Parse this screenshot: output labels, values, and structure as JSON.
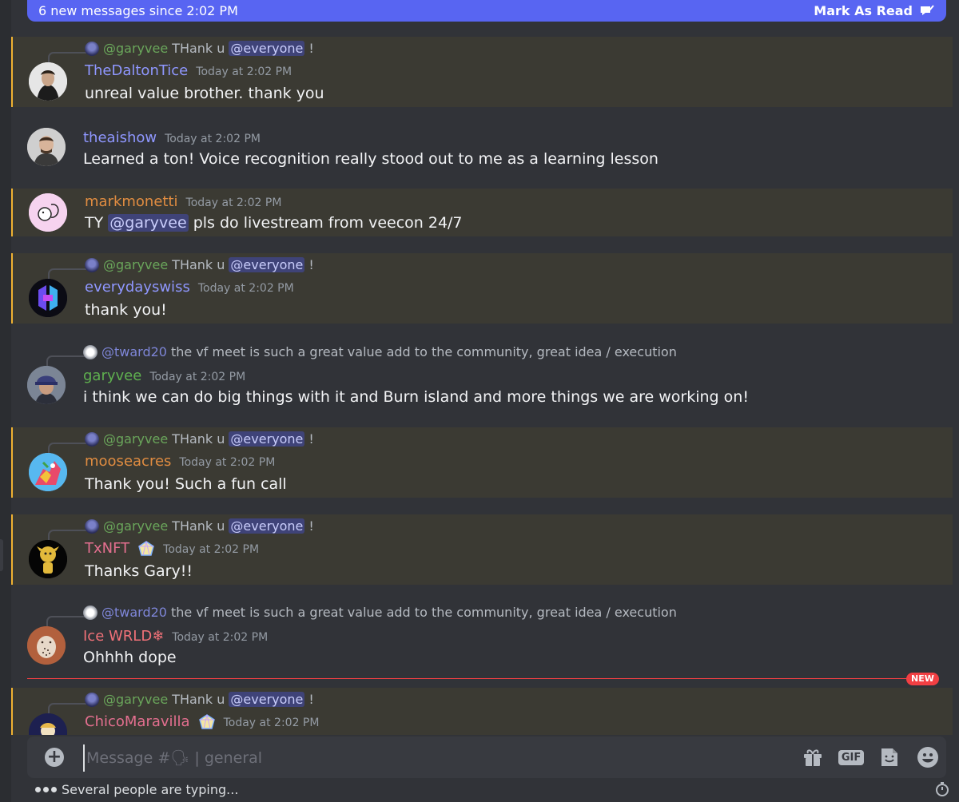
{
  "banner": {
    "text": "6 new messages since 2:02 PM",
    "action": "Mark As Read"
  },
  "messages": [
    {
      "reply": {
        "user": "@garyvee",
        "text": "THank u",
        "mention": "@everyone",
        "tail": "!"
      },
      "author": "TheDaltonTice",
      "time": "Today at 2:02 PM",
      "content": "unreal value brother. thank you"
    },
    {
      "author": "theaishow",
      "time": "Today at 2:02 PM",
      "content": "Learned a ton! Voice recognition really stood out to me as a learning lesson"
    },
    {
      "author": "markmonetti",
      "time": "Today at 2:02 PM",
      "content": {
        "pre": "TY",
        "mention": "@garyvee",
        "post": "pls do livestream from veecon 24/7"
      }
    },
    {
      "reply": {
        "user": "@garyvee",
        "text": "THank u",
        "mention": "@everyone",
        "tail": "!"
      },
      "author": "everydayswiss",
      "time": "Today at 2:02 PM",
      "content": "thank you!"
    },
    {
      "reply": {
        "user": "@tward20",
        "text": "the vf meet is such a great value add to the community, great idea / execution"
      },
      "author": "garyvee",
      "time": "Today at 2:02 PM",
      "content": "i think we can do big things with it and Burn island and more things we are working on!"
    },
    {
      "reply": {
        "user": "@garyvee",
        "text": "THank u",
        "mention": "@everyone",
        "tail": "!"
      },
      "author": "mooseacres",
      "time": "Today at 2:02 PM",
      "content": "Thank you! Such a fun call"
    },
    {
      "reply": {
        "user": "@garyvee",
        "text": "THank u",
        "mention": "@everyone",
        "tail": "!"
      },
      "author": "TxNFT",
      "time": "Today at 2:02 PM",
      "content": "Thanks Gary!!"
    },
    {
      "reply": {
        "user": "@tward20",
        "text": "the vf meet is such a great value add to the community, great idea / execution"
      },
      "author": "Ice WRLD❄",
      "time": "Today at 2:02 PM",
      "content": "Ohhhh dope"
    },
    {
      "reply": {
        "user": "@garyvee",
        "text": "THank u",
        "mention": "@everyone",
        "tail": "!"
      },
      "author": "ChicoMaravilla",
      "time": "Today at 2:02 PM",
      "content": ""
    }
  ],
  "new_label": "NEW",
  "composer": {
    "placeholder": "Message #🗣 | general",
    "gif_label": "GIF",
    "icons": [
      "plus-icon",
      "gift-icon",
      "gif-icon",
      "sticker-icon",
      "emoji-icon"
    ]
  },
  "typing": {
    "text": "Several people are typing..."
  },
  "colors": {
    "accent": "#5865f2",
    "highlight": "#f0b232",
    "new": "#f23f43",
    "background": "#313338"
  }
}
